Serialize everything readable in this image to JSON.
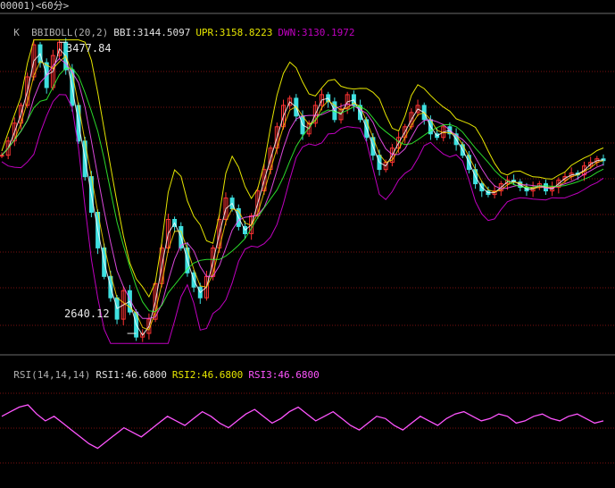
{
  "window_title": "00001)<60分>",
  "colors": {
    "background": "#000000",
    "grid": "#7a1010",
    "axis_frame": "#6b6b6b",
    "candle_up": "#ff3333",
    "candle_down": "#3fe0e0",
    "ma_lines": [
      "#ffffff",
      "#ffd700",
      "#ff55ff",
      "#33ff33"
    ],
    "boll_upper": "#e6e600",
    "boll_lower": "#c000c0",
    "rsi_line": "#ff55ff",
    "bbi": "#cfcfcf"
  },
  "kline_panel": {
    "indicator_label": "K  BBIBOLL(20,2)",
    "bbi_label": "BBI:3144.5097",
    "upr_label": "UPR:3158.8223",
    "dwn_label": "DWN:3130.1972",
    "max_label": "3477.84",
    "min_label": "2640.12"
  },
  "rsi_panel": {
    "indicator_label": "RSI(14,14,14)",
    "rsi1_label": "RSI1:46.6800",
    "rsi2_label": "RSI2:46.6800",
    "rsi3_label": "RSI3:46.6800"
  },
  "chart_data": [
    {
      "type": "candlestick",
      "title": "",
      "y_range": [
        2640.12,
        3477.84
      ],
      "grid": true,
      "close": [
        3160,
        3200,
        3250,
        3300,
        3380,
        3470,
        3420,
        3350,
        3440,
        3477,
        3400,
        3300,
        3200,
        3100,
        3000,
        2900,
        2820,
        2760,
        2700,
        2780,
        2720,
        2650,
        2660,
        2700,
        2800,
        2900,
        2980,
        2960,
        2900,
        2830,
        2790,
        2760,
        2820,
        2900,
        2980,
        3040,
        3010,
        2960,
        2940,
        2990,
        3060,
        3120,
        3180,
        3240,
        3300,
        3320,
        3270,
        3220,
        3250,
        3300,
        3330,
        3310,
        3260,
        3290,
        3330,
        3300,
        3260,
        3210,
        3160,
        3120,
        3140,
        3180,
        3210,
        3240,
        3280,
        3300,
        3260,
        3220,
        3210,
        3240,
        3220,
        3190,
        3160,
        3120,
        3080,
        3060,
        3050,
        3060,
        3080,
        3090,
        3085,
        3070,
        3060,
        3070,
        3080,
        3060,
        3070,
        3090,
        3100,
        3110,
        3105,
        3130,
        3140,
        3150,
        3145
      ]
    },
    {
      "type": "line",
      "title": "",
      "series": [
        {
          "name": "RSI1",
          "values": [
            58,
            62,
            66,
            68,
            60,
            54,
            58,
            52,
            46,
            40,
            34,
            30,
            36,
            42,
            48,
            44,
            40,
            46,
            52,
            58,
            54,
            50,
            56,
            62,
            58,
            52,
            48,
            54,
            60,
            64,
            58,
            52,
            56,
            62,
            66,
            60,
            54,
            58,
            62,
            56,
            50,
            46,
            52,
            58,
            56,
            50,
            46,
            52,
            58,
            54,
            50,
            56,
            60,
            62,
            58,
            54,
            56,
            60,
            58,
            52,
            54,
            58,
            60,
            56,
            54,
            58,
            60,
            56,
            52,
            54
          ]
        }
      ],
      "y_range": [
        0,
        100
      ],
      "grid": true
    }
  ]
}
